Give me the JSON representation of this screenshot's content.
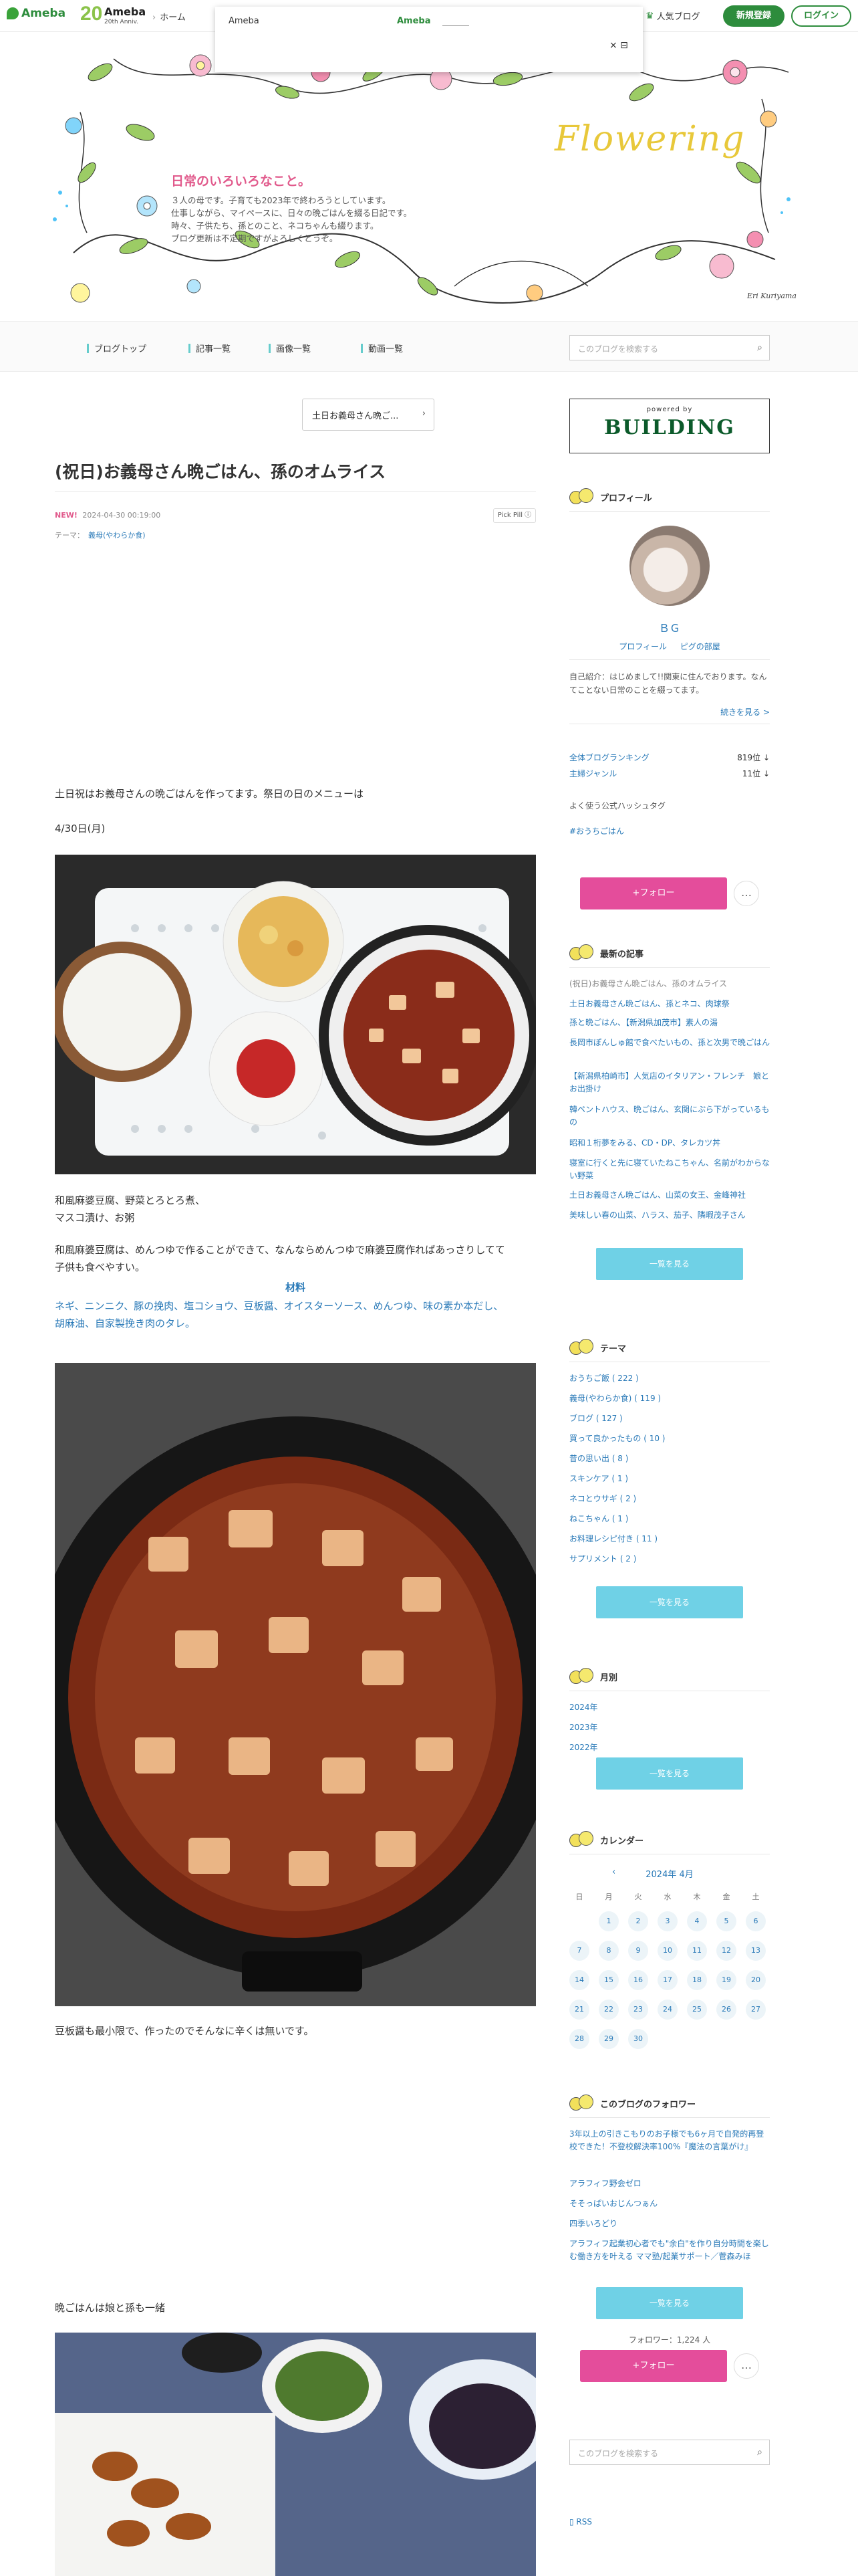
{
  "topbar": {
    "logo": "Ameba",
    "anniv_num": "20",
    "anniv_title": "Ameba",
    "anniv_sub": "20th Anniv.",
    "home": "ホーム",
    "popular": "人気ブログ",
    "register": "新規登録",
    "login": "ログイン"
  },
  "popup": {
    "title": "Ameba",
    "link": "Ameba",
    "close": "× ⊟"
  },
  "header": {
    "title": "日常のいろいろなこと。",
    "desc": [
      "３人の母です。子育ても2023年で終わろうとしています。",
      "仕事しながら、マイペースに、日々の晩ごはんを綴る日記です。",
      "時々、子供たち、孫とのこと、ネコちゃんも綴ります。",
      "ブログ更新は不定期ですがよろしくどうぞ。"
    ],
    "flowering": "Flowering",
    "signature": "Eri Kuriyama"
  },
  "nav": {
    "items": [
      "ブログトップ",
      "記事一覧",
      "画像一覧",
      "動画一覧"
    ],
    "search_placeholder": "このブログを検索する"
  },
  "article": {
    "pager": "土日お義母さん晩ご...",
    "title": "(祝日)お義母さん晩ごはん、孫のオムライス",
    "new": "NEW!",
    "date": "2024-04-30 00:19:00",
    "pickpill": "Pick Pill ⓘ",
    "theme_label": "テーマ：",
    "theme": "義母(やわらか食)",
    "p1": "土日祝はお義母さんの晩ごはんを作ってます。祭日の日のメニューは",
    "p2": "4/30日(月)",
    "p3a": "和風麻婆豆腐、野菜とろとろ煮、",
    "p3b": "マスコ漬け、お粥",
    "p4a": "和風麻婆豆腐は、めんつゆで作ることができて、なんならめんつゆで麻婆豆腐作ればあっさりしてて",
    "p4b": "子供も食べやすい。",
    "material_title": "材料",
    "mat1": "ネギ、ニンニク、豚の挽肉、塩コショウ、豆板醤、オイスターソース、めんつゆ、味の素か本だし、",
    "mat2": "胡麻油、自家製挽き肉のタレ。",
    "p5": "豆板醤も最小限で、作ったのでそんなに辛くは無いです。",
    "p6": "晩ごはんは娘と孫も一緒"
  },
  "sidebar": {
    "ad_powered": "powered by",
    "ad_brand": "BUILDING",
    "profile_head": "プロフィール",
    "name": "ＢＧ",
    "profile_link": "プロフィール",
    "pigg_link": "ピグの部屋",
    "intro": "自己紹介：はじめまして!!関東に住んでおります。なんてことない日常のことを綴ってます。",
    "read_more": "続きを見る >",
    "rank1_label": "全体ブログランキング",
    "rank1_value": "819位 ↓",
    "rank2_label": "主婦ジャンル",
    "rank2_value": "11位 ↓",
    "hashtag_head": "よく使う公式ハッシュタグ",
    "hashtag": "#おうちごはん",
    "follow": "+フォロー",
    "more": "…",
    "recent_head": "最新の記事",
    "recent": [
      "(祝日)お義母さん晩ごはん、孫のオムライス",
      "土日お義母さん晩ごはん、孫とネコ、肉球祭",
      "孫と晩ごはん、【新潟県加茂市】素人の湯",
      "長岡市ぽんしゅ館で食べたいもの、孫と次男で晩ごはん",
      "【新潟県柏崎市】人気店のイタリアン・フレンチ　娘とお出掛け",
      "韓ペントハウス、晩ごはん、玄関にぷら下がっているもの",
      "昭和１桁夢をみる、CD・DP、タレカツ丼",
      "寝室に行くと先に寝ていたねこちゃん、名前がわからない野菜",
      "土日お義母さん晩ごはん、山菜の女王、金峰神社",
      "美味しい春の山菜、ハラス、茄子、隣暇茂子さん"
    ],
    "list_btn": "一覧を見る",
    "theme_head": "テーマ",
    "themes": [
      "おうちご飯 ( 222 )",
      "義母(やわらか食) ( 119 )",
      "ブログ ( 127 )",
      "買って良かったもの ( 10 )",
      "昔の思い出 ( 8 )",
      "スキンケア ( 1 )",
      "ネコとウサギ ( 2 )",
      "ねこちゃん ( 1 )",
      "お料理レシピ付き ( 11 )",
      "サプリメント ( 2 )"
    ],
    "month_head": "月別",
    "months": [
      "2024年",
      "2023年",
      "2022年"
    ],
    "calendar_head": "カレンダー",
    "cal_title": "2024年 4月",
    "cal_prev": "‹",
    "weekdays": [
      "日",
      "月",
      "火",
      "水",
      "木",
      "金",
      "土"
    ],
    "days": [
      "1",
      "2",
      "3",
      "4",
      "5",
      "6",
      "7",
      "8",
      "9",
      "10",
      "11",
      "12",
      "13",
      "14",
      "15",
      "16",
      "17",
      "18",
      "19",
      "20",
      "21",
      "22",
      "23",
      "24",
      "25",
      "26",
      "27",
      "28",
      "29",
      "30"
    ],
    "followees_head": "このブログのフォロワー",
    "followees": [
      "3年以上の引きこもりのお子様でも6ヶ月で自発的再登校できた！不登校解決率100%『魔法の言葉がけ』",
      "アラフィフ野会ゼロ",
      "そそっぱいおじんつぁん",
      "四季いろどり",
      "アラフィフ起業初心者でも\"余白\"を作り自分時間を楽しむ働き方を叶える ママ塾/起業サポート／菅森みほ"
    ],
    "follower_count": "フォロワー：1,224 人",
    "search_placeholder": "このブログを検索する",
    "rss": "RSS"
  }
}
